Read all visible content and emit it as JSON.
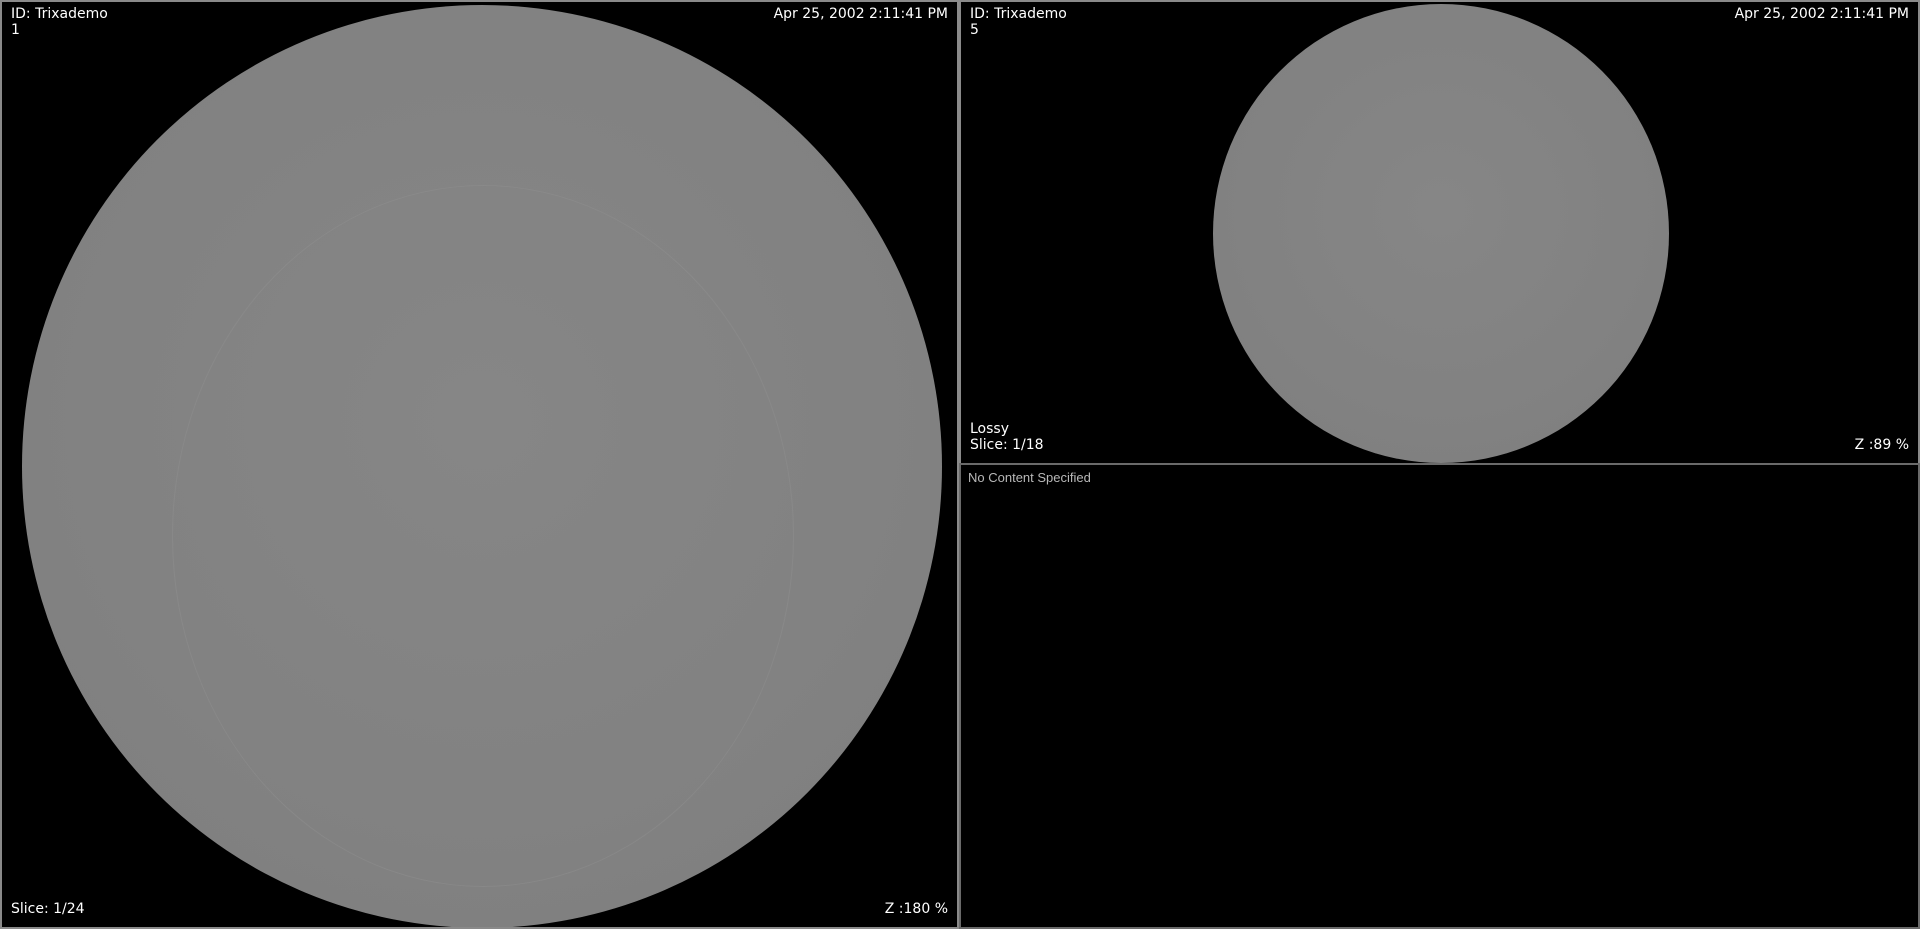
{
  "viewports": [
    {
      "id": "ID: Trixademo",
      "series": "1",
      "date": "Apr 25, 2002 2:11:41 PM",
      "slice": "Slice: 1/24",
      "zoom": "Z :180 %"
    },
    {
      "id": "ID: Trixademo",
      "series": "5",
      "date": "Apr 25, 2002 2:11:41 PM",
      "compression": "Lossy",
      "slice": "Slice: 1/18",
      "zoom": "Z :89 %"
    },
    {
      "empty_text": "No Content Specified"
    }
  ],
  "colors": {
    "background": "#000000",
    "image_gray": "#828282",
    "border": "#8a8a8a"
  }
}
